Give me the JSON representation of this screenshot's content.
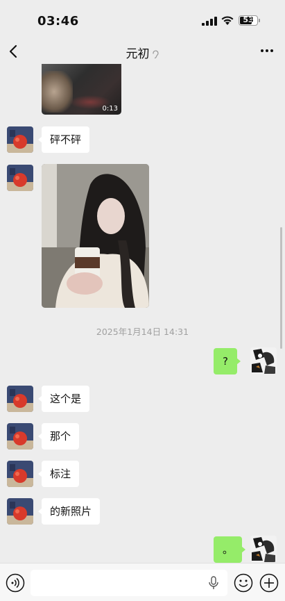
{
  "status_bar": {
    "time": "03:46",
    "battery": "53"
  },
  "header": {
    "title": "元初"
  },
  "messages": {
    "video_duration": "0:13",
    "m1": "砰不砰",
    "timestamp": "2025年1月14日 14:31",
    "m_right1": "?",
    "m2": "这个是",
    "m3": "那个",
    "m4": "标注",
    "m5": "的新照片",
    "m_right2": "。"
  },
  "icons": [
    "back-icon",
    "ear-icon",
    "more-icon",
    "voice-icon",
    "mic-icon",
    "emoji-icon",
    "plus-icon"
  ]
}
